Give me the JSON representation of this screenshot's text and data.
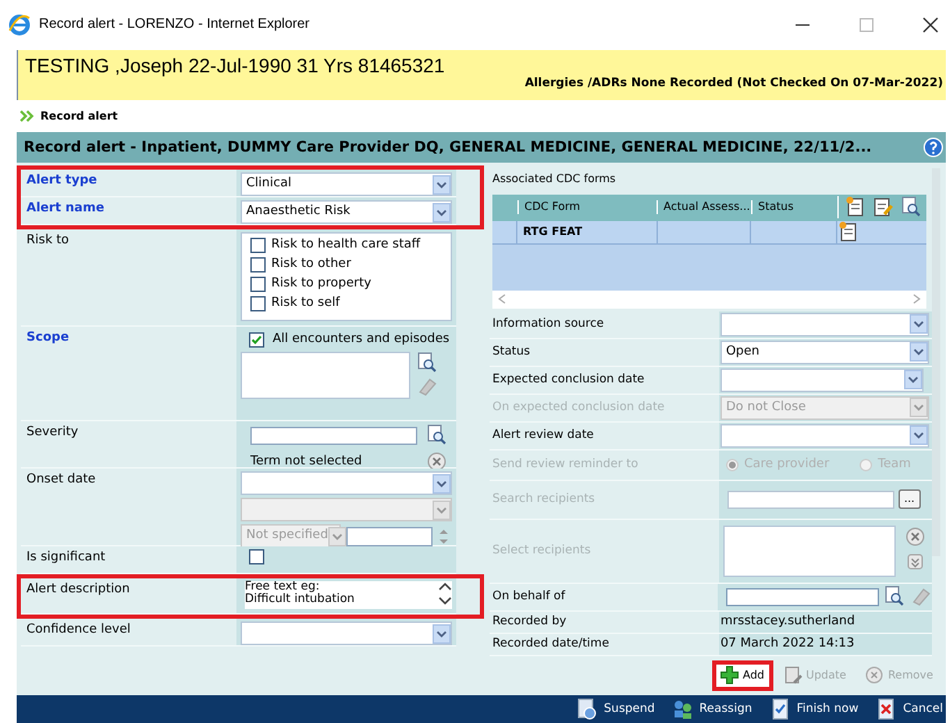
{
  "window": {
    "title": "Record alert - LORENZO - Internet Explorer"
  },
  "patient_banner": {
    "name": "TESTING ,Joseph 22-Jul-1990 31 Yrs 81465321",
    "allergies": "Allergies /ADRs None Recorded (Not Checked On 07-Mar-2022)"
  },
  "breadcrumb": "Record alert",
  "header": "Record alert - Inpatient, DUMMY Care Provider DQ, GENERAL MEDICINE, GENERAL MEDICINE, 22/11/2...",
  "left_fields": [
    {
      "kind": "select",
      "label": "Alert type",
      "value": "Clinical",
      "mandatory": true,
      "highlighted": true
    },
    {
      "kind": "select",
      "label": "Alert name",
      "value": "Anaesthetic Risk",
      "mandatory": true,
      "highlighted": true
    },
    {
      "kind": "checklist",
      "label": "Risk to",
      "mandatory": false,
      "highlighted": false,
      "options": [
        {
          "label": "Risk to health care staff",
          "checked": false
        },
        {
          "label": "Risk to other",
          "checked": false
        },
        {
          "label": "Risk to property",
          "checked": false
        },
        {
          "label": "Risk to self",
          "checked": false
        }
      ]
    },
    {
      "kind": "scope",
      "label": "Scope",
      "mandatory": true,
      "highlighted": false,
      "options": [
        {
          "label": "All encounters and episodes",
          "checked": true
        }
      ]
    },
    {
      "kind": "term",
      "label": "Severity",
      "note": "Term not selected",
      "mandatory": false,
      "highlighted": false
    },
    {
      "kind": "onset",
      "label": "Onset date",
      "value": "Not specified",
      "mandatory": false,
      "highlighted": false
    },
    {
      "kind": "checkbox",
      "label": "Is significant",
      "checked": false,
      "mandatory": false,
      "highlighted": false
    },
    {
      "kind": "textarea",
      "label": "Alert description",
      "value": "Free text eg:\nDifficult intubation",
      "mandatory": false,
      "highlighted": true
    },
    {
      "kind": "select",
      "label": "Confidence level",
      "mandatory": false,
      "highlighted": false
    }
  ],
  "cdc_forms": {
    "label": "Associated CDC forms",
    "columns": [
      "CDC Form",
      "Actual Assess...",
      "Status"
    ],
    "rows": [
      {
        "cdc_form": "RTG FEAT",
        "selected": true
      }
    ]
  },
  "right_fields": [
    {
      "kind": "select",
      "label": "Information source",
      "disabled": false
    },
    {
      "kind": "select",
      "label": "Status",
      "value": "Open",
      "disabled": false
    },
    {
      "kind": "date",
      "label": "Expected conclusion date",
      "disabled": false
    },
    {
      "kind": "select",
      "label": "On expected conclusion date",
      "value": "Do not Close",
      "disabled": true
    },
    {
      "kind": "select",
      "label": "Alert review date",
      "disabled": false
    },
    {
      "kind": "radios",
      "label": "Send review reminder to",
      "disabled": true,
      "options": [
        {
          "label": "Care provider",
          "selected": true
        },
        {
          "label": "Team",
          "selected": false
        }
      ]
    },
    {
      "kind": "search",
      "label": "Search recipients",
      "button": "...",
      "disabled": true
    },
    {
      "kind": "list",
      "label": "Select recipients",
      "disabled": true
    },
    {
      "kind": "person",
      "label": "On behalf of",
      "disabled": false
    },
    {
      "kind": "text",
      "label": "Recorded by",
      "value": "mrsstacey.sutherland",
      "disabled": false
    },
    {
      "kind": "text",
      "label": "Recorded date/time",
      "value": "07 March 2022 14:13",
      "disabled": false
    }
  ],
  "actions": [
    {
      "label": "Add",
      "kind": "add",
      "disabled": false,
      "highlighted": true
    },
    {
      "label": "Update",
      "kind": "update",
      "disabled": true,
      "highlighted": false
    },
    {
      "label": "Remove",
      "kind": "remove",
      "disabled": true,
      "highlighted": false
    }
  ],
  "footer": [
    {
      "label": "Suspend",
      "kind": "suspend"
    },
    {
      "label": "Reassign",
      "kind": "reassign"
    },
    {
      "label": "Finish now",
      "kind": "finish"
    },
    {
      "label": "Cancel",
      "kind": "cancel"
    }
  ]
}
